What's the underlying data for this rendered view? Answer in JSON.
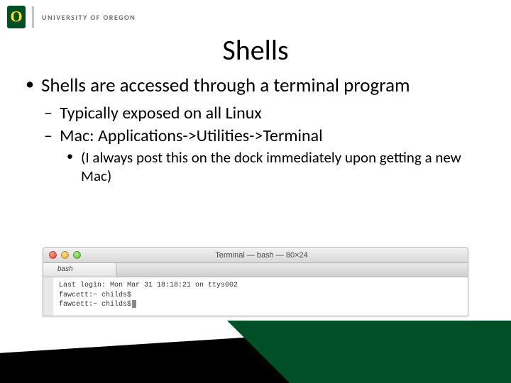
{
  "header": {
    "institution": "UNIVERSITY OF OREGON"
  },
  "title": "Shells",
  "bullets": {
    "b1": "Shells are accessed through a terminal program",
    "b2a": "Typically exposed on all Linux",
    "b2b": "Mac: Applications->Utilities->Terminal",
    "b3": "(I always post this on the dock immediately upon getting a new Mac)"
  },
  "terminal": {
    "title": "Terminal — bash — 80×24",
    "tab": "bash",
    "line1": "Last login: Mon Mar 31 18:18:21 on ttys002",
    "line2": "fawcett:~ childs$",
    "line3": "fawcett:~ childs$"
  },
  "colors": {
    "brand_green": "#004F27",
    "brand_yellow": "#FEE123"
  }
}
